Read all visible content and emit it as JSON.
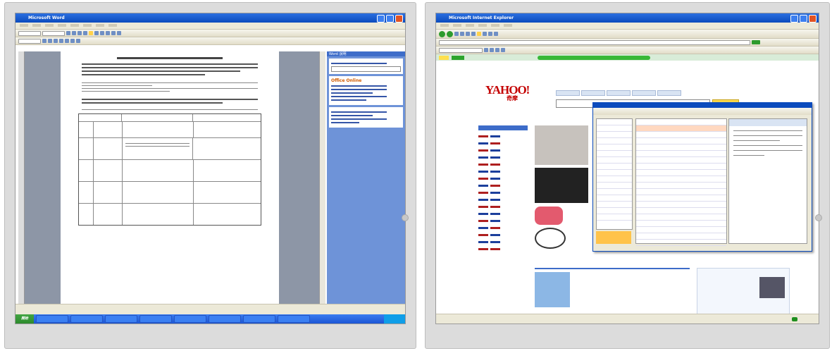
{
  "left_monitor": {
    "window_title": "Microsoft Word",
    "taskbar": {
      "start_label": "開始",
      "clock": ""
    },
    "side_panel": {
      "title": "Word 說明",
      "office_online": "Office Online"
    }
  },
  "right_monitor": {
    "window_title": "Microsoft Internet Explorer",
    "yahoo": {
      "logo": "YAHOO!",
      "logo_cn": "奇摩"
    },
    "status": {}
  },
  "colors": {
    "xp_title": "#0b4bbd",
    "xp_taskbar": "#2560dc",
    "start_green": "#3a9a3a",
    "yahoo_red": "#c40000",
    "bezel": "#dcdcdc"
  }
}
